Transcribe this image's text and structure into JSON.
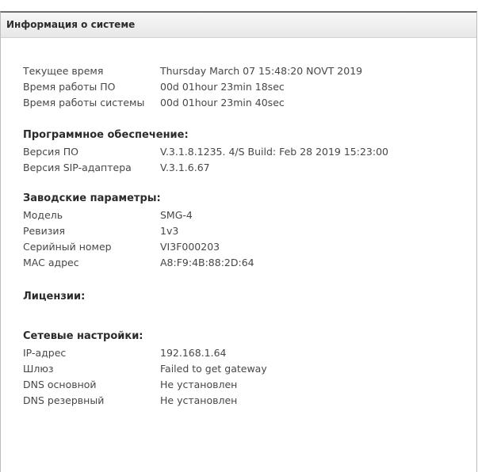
{
  "panel": {
    "title": "Информация о системе"
  },
  "time": [
    {
      "label": "Текущее время",
      "value": "Thursday March 07 15:48:20 NOVT 2019"
    },
    {
      "label": "Время работы ПО",
      "value": "00d 01hour 23min 18sec"
    },
    {
      "label": "Время работы системы",
      "value": "00d 01hour 23min 40sec"
    }
  ],
  "software": {
    "title": "Программное обеспечение:",
    "rows": [
      {
        "label": "Версия ПО",
        "value": "V.3.1.8.1235. 4/S Build: Feb 28 2019 15:23:00"
      },
      {
        "label": "Версия SIP-адаптера",
        "value": "V.3.1.6.67"
      }
    ]
  },
  "factory": {
    "title": "Заводские параметры:",
    "rows": [
      {
        "label": "Модель",
        "value": "SMG-4"
      },
      {
        "label": "Ревизия",
        "value": "1v3"
      },
      {
        "label": "Серийный номер",
        "value": "VI3F000203"
      },
      {
        "label": "MAC адрес",
        "value": "A8:F9:4B:88:2D:64"
      }
    ]
  },
  "licenses": {
    "title": "Лицензии:"
  },
  "network": {
    "title": "Сетевые настройки:",
    "rows": [
      {
        "label": "IP-адрес",
        "value": "192.168.1.64"
      },
      {
        "label": "Шлюз",
        "value": "Failed to get gateway"
      },
      {
        "label": "DNS основной",
        "value": "Не установлен"
      },
      {
        "label": "DNS резервный",
        "value": "Не установлен"
      }
    ]
  }
}
